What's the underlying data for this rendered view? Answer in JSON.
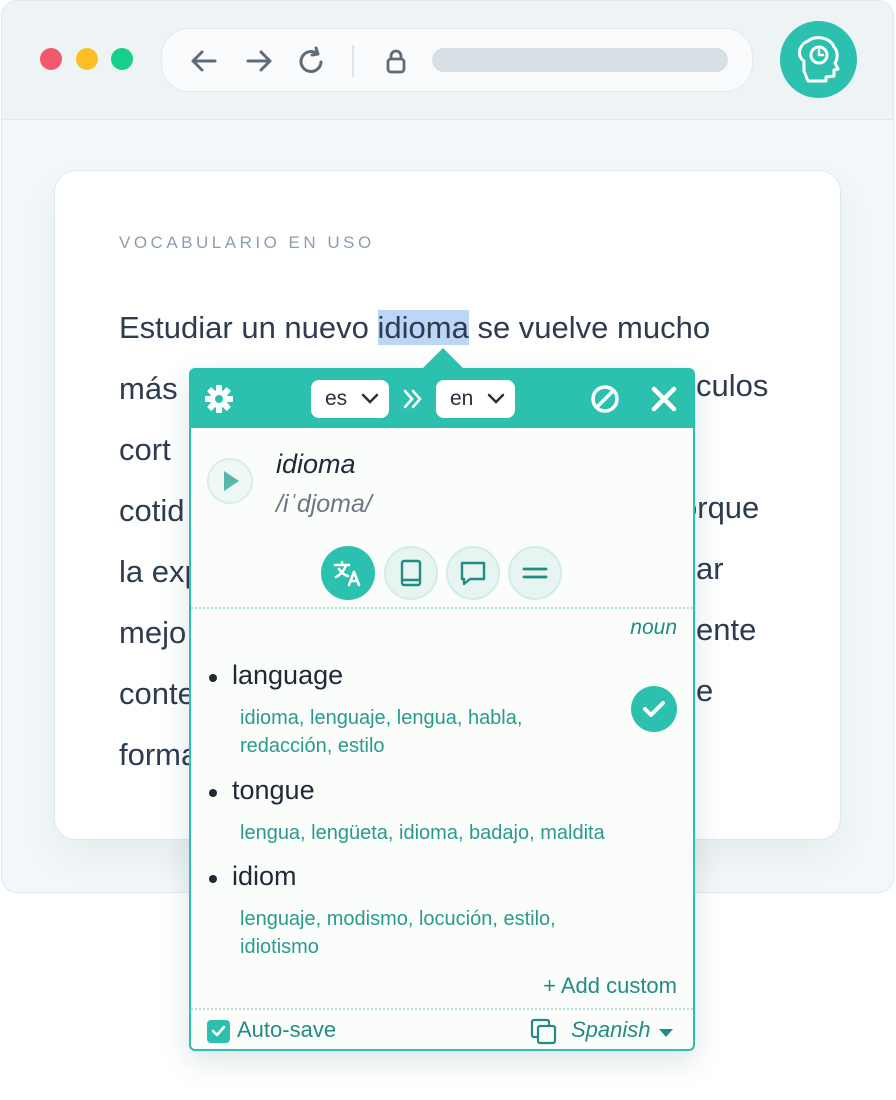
{
  "browser": {
    "window_dots": [
      {
        "name": "close",
        "color": "#f0596e"
      },
      {
        "name": "minimize",
        "color": "#fbbf24"
      },
      {
        "name": "maximize",
        "color": "#14d08a"
      }
    ],
    "icons": {
      "back": "arrow-left-icon",
      "forward": "arrow-right-icon",
      "reload": "reload-icon",
      "lock": "lock-icon",
      "extension": "brain-clock-icon"
    },
    "accent_color": "#2cc0ae"
  },
  "article": {
    "eyebrow": "VOCABULARIO EN USO",
    "before": "Estudiar un nuevo ",
    "highlight": "idioma",
    "after": " se vuelve mucho",
    "visible_lines": [
      "más",
      "cort",
      "cotid",
      "la exp",
      "mejo",
      "conte",
      "forma"
    ],
    "visible_right_fragments": [
      "culos",
      "orque",
      "ar",
      "ente",
      "e"
    ]
  },
  "popup": {
    "source_lang": "es",
    "target_lang": "en",
    "header_icons": [
      "gear-icon",
      "double-chevron-right-icon",
      "ban-icon",
      "close-icon"
    ],
    "word": "idioma",
    "phonetic": "/iˈdjoma/",
    "tabs": [
      "translate-icon",
      "book-icon",
      "speech-bubble-icon",
      "equals-icon"
    ],
    "part_of_speech": "noun",
    "senses": [
      {
        "word": "language",
        "synonyms": "idioma, lenguaje, lengua, habla, redacción, estilo",
        "saved": true
      },
      {
        "word": "tongue",
        "synonyms": "lengua, lengüeta, idioma, badajo, maldita",
        "saved": false
      },
      {
        "word": "idiom",
        "synonyms": "lenguaje, modismo, locución, estilo, idiotismo",
        "saved": false
      }
    ],
    "add_custom": "+ Add custom",
    "auto_save_label": "Auto-save",
    "auto_save_checked": true,
    "language_menu": "Spanish"
  }
}
